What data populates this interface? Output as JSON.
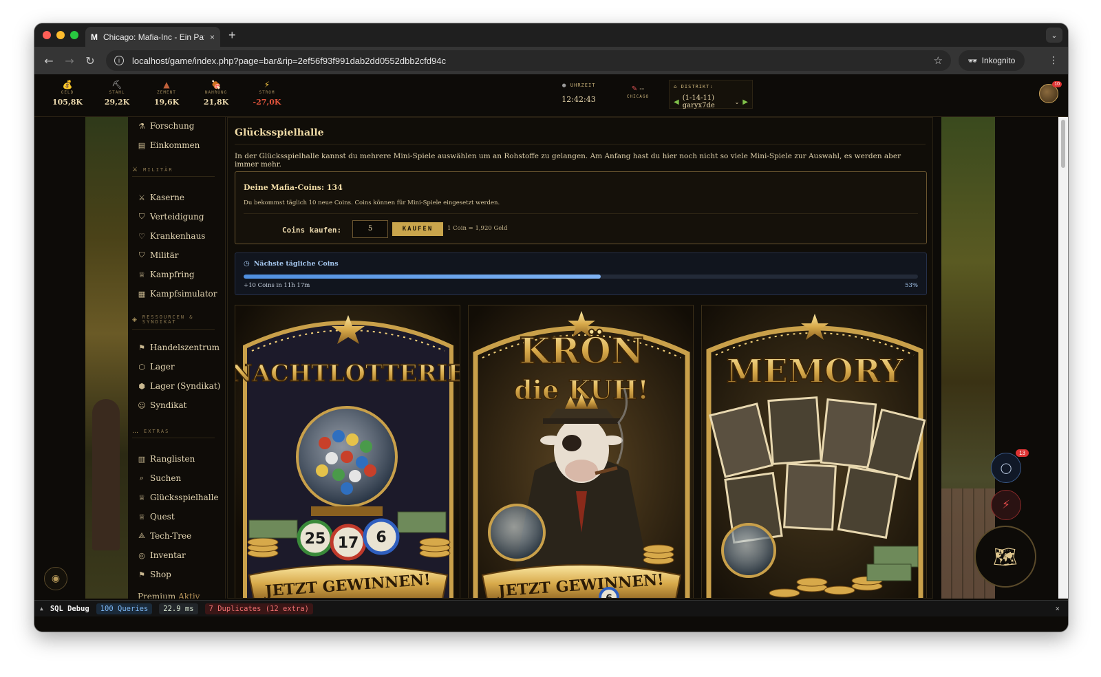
{
  "browser": {
    "tab_favicon": "M",
    "tab_title": "Chicago: Mafia-Inc - Ein Pate",
    "tab_close": "×",
    "new_tab": "+",
    "url": "localhost/game/index.php?page=bar&rip=2ef56f93f991dab2dd0552dbb2cfd94c",
    "incognito_label": "Inkognito"
  },
  "resources": [
    {
      "label": "GELD",
      "value": "105,8K",
      "icon": "money-bag-icon"
    },
    {
      "label": "STAHL",
      "value": "29,2K",
      "icon": "steel-icon"
    },
    {
      "label": "ZEMENT",
      "value": "19,6K",
      "icon": "cement-icon"
    },
    {
      "label": "NAHRUNG",
      "value": "21,8K",
      "icon": "food-icon"
    },
    {
      "label": "STROM",
      "value": "-27,0K",
      "icon": "lightning-icon"
    }
  ],
  "clock": {
    "label": "UHRZEIT",
    "value": "12:42:43"
  },
  "city": {
    "value": "--",
    "label": "CHICAGO"
  },
  "district": {
    "label": "DISTRIKT:",
    "value": "(1-14-11) garyx7de"
  },
  "avatar_badge": "10",
  "sidebar": {
    "top_items": [
      "Forschung",
      "Einkommen"
    ],
    "section_military": "MILITÄR",
    "military_items": [
      "Kaserne",
      "Verteidigung",
      "Krankenhaus",
      "Militär",
      "Kampfring",
      "Kampfsimulator"
    ],
    "section_resources": "RESSOURCEN & SYNDIKAT",
    "resource_items": [
      "Handelszentrum",
      "Lager",
      "Lager (Syndikat)",
      "Syndikat"
    ],
    "section_extras": "EXTRAS",
    "extra_items": [
      "Ranglisten",
      "Suchen",
      "Glücksspielhalle",
      "Quest",
      "Tech-Tree",
      "Inventar",
      "Shop"
    ],
    "premium_label": "Premium",
    "premium_status": "Aktiv"
  },
  "main": {
    "title": "Glücksspielhalle",
    "intro": "In der Glücksspielhalle kannst du mehrere Mini-Spiele auswählen um an Rohstoffe zu gelangen. Am Anfang hast du hier noch nicht so viele Mini-Spiele zur Auswahl, es werden aber immer mehr.",
    "coins_heading": "Deine Mafia-Coins: 134",
    "coins_sub": "Du bekommst täglich 10 neue Coins. Coins können für Mini-Spiele eingesetzt werden.",
    "buy_label": "Coins kaufen:",
    "buy_value": "5",
    "buy_button": "KAUFEN",
    "buy_rate": "1 Coin = 1,920 Geld",
    "timer_heading": "Nächste tägliche Coins",
    "timer_left": "+10 Coins in 11h 17m",
    "timer_percent_label": "53%",
    "timer_progress": 0.53
  },
  "games": [
    {
      "title": "NACHTLOTTERIE",
      "cta": "JETZT GEWINNEN!",
      "balls": [
        "25",
        "17",
        "6"
      ]
    },
    {
      "title_line1": "KRÖN",
      "title_line2": "die KUH!",
      "cta": "JETZT GEWINNEN!",
      "ball": "6"
    },
    {
      "title": "MEMORY"
    }
  ],
  "floating": {
    "chat_badge": "13"
  },
  "debug": {
    "label": "SQL Debug",
    "queries": "100 Queries",
    "time": "22.9 ms",
    "duplicates": "7 Duplicates (12 extra)",
    "close": "×"
  },
  "colors": {
    "accent_gold": "#c9a54c",
    "text_cream": "#e9d7ac",
    "progress_blue": "#5a9be6",
    "negative_red": "#e0533b"
  }
}
